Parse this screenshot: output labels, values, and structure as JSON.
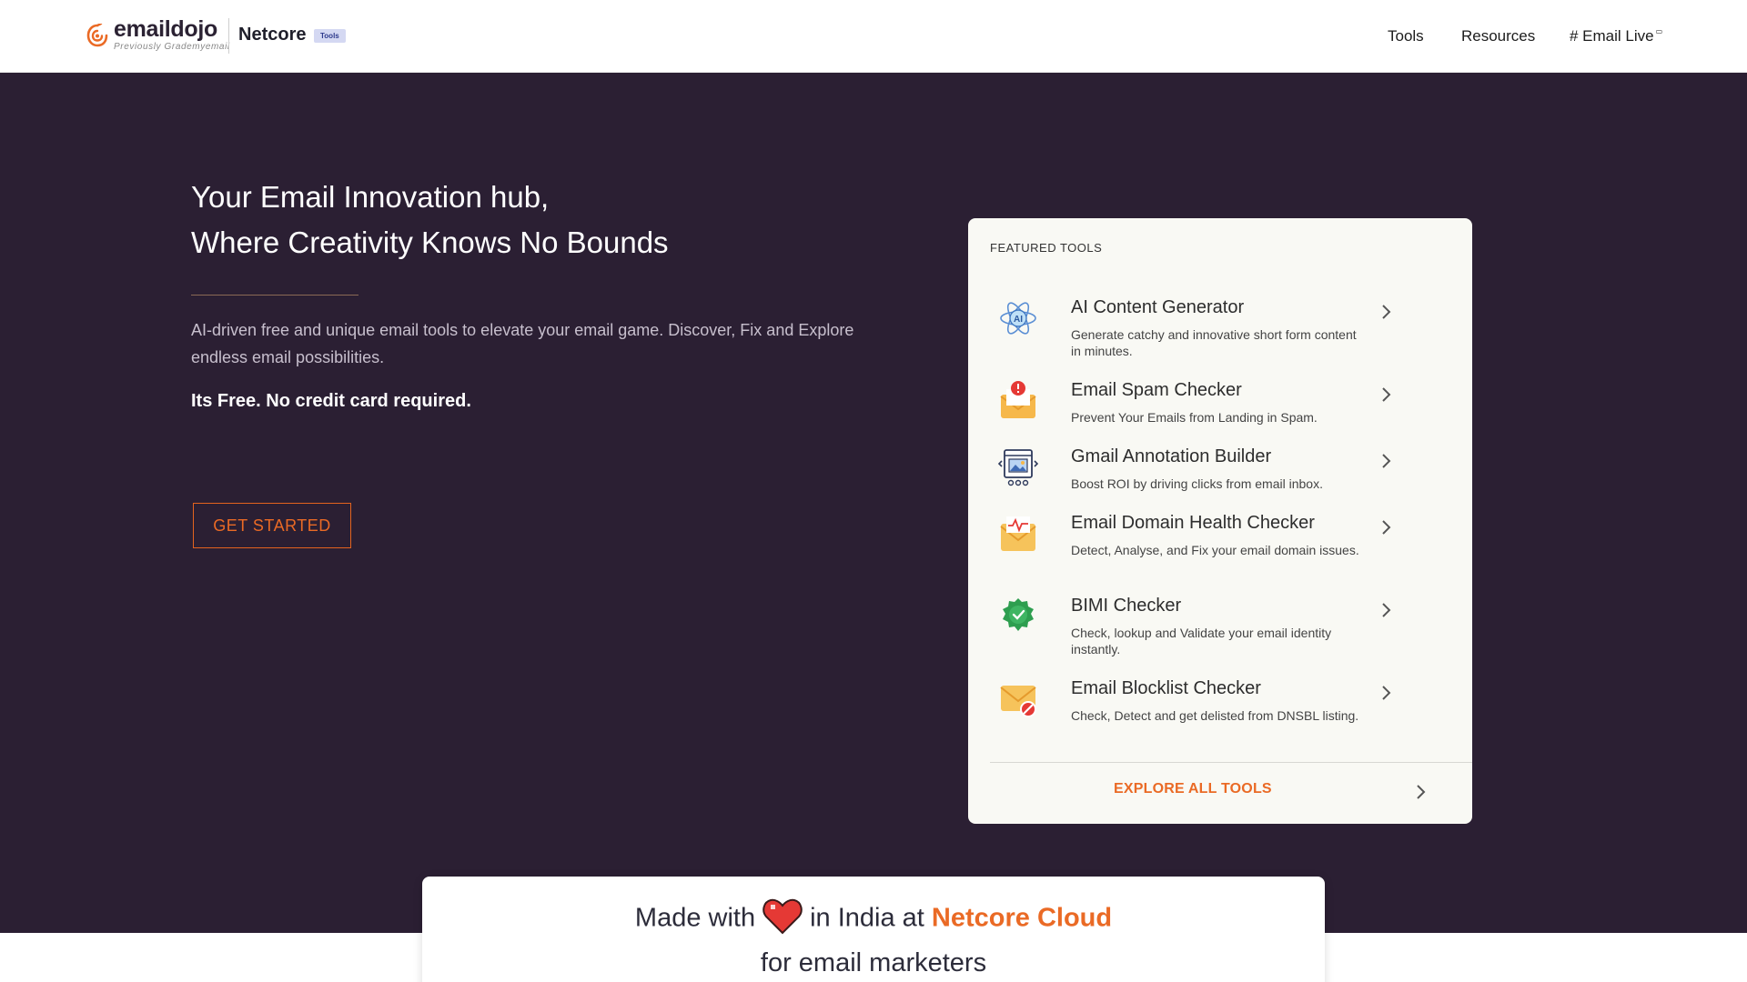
{
  "header": {
    "logo_name": "emaildojo",
    "logo_sub": "Previously Grademyemail",
    "partner": "Netcore",
    "badge": "Tools",
    "nav": {
      "tools": "Tools",
      "resources": "Resources",
      "email_live": "# Email Live",
      "external_icon": "external-link-icon"
    }
  },
  "hero": {
    "title_line1": "Your Email Innovation hub,",
    "title_line2": "Where Creativity Knows No Bounds",
    "description": "AI-driven free and unique email tools to elevate your email game. Discover, Fix and Explore endless email possibilities.",
    "free_text": "Its Free. No credit card required.",
    "cta": "GET STARTED"
  },
  "featured": {
    "label": "FEATURED TOOLS",
    "tools": [
      {
        "title": "AI Content Generator",
        "desc": "Generate catchy and innovative short form content in minutes.",
        "icon": "ai-atom-icon"
      },
      {
        "title": "Email Spam Checker",
        "desc": "Prevent Your Emails from Landing in Spam.",
        "icon": "spam-envelope-icon"
      },
      {
        "title": "Gmail Annotation Builder",
        "desc": "Boost ROI by driving clicks from email inbox.",
        "icon": "annotation-browser-icon"
      },
      {
        "title": "Email Domain Health Checker",
        "desc": "Detect, Analyse, and Fix your email domain issues.",
        "icon": "health-envelope-icon"
      },
      {
        "title": "BIMI Checker",
        "desc": "Check, lookup and Validate your email identity instantly.",
        "icon": "verified-badge-icon"
      },
      {
        "title": "Email Blocklist Checker",
        "desc": "Check, Detect and get delisted from DNSBL listing.",
        "icon": "blocked-envelope-icon"
      }
    ],
    "explore": "EXPLORE ALL TOOLS"
  },
  "banner": {
    "made_with": "Made with",
    "in_india": "in India at",
    "brand": "Netcore Cloud",
    "line2": "for email marketers"
  },
  "colors": {
    "hero_bg": "#2b1f33",
    "accent": "#ea6a25",
    "card_bg": "#f9f9f4"
  }
}
